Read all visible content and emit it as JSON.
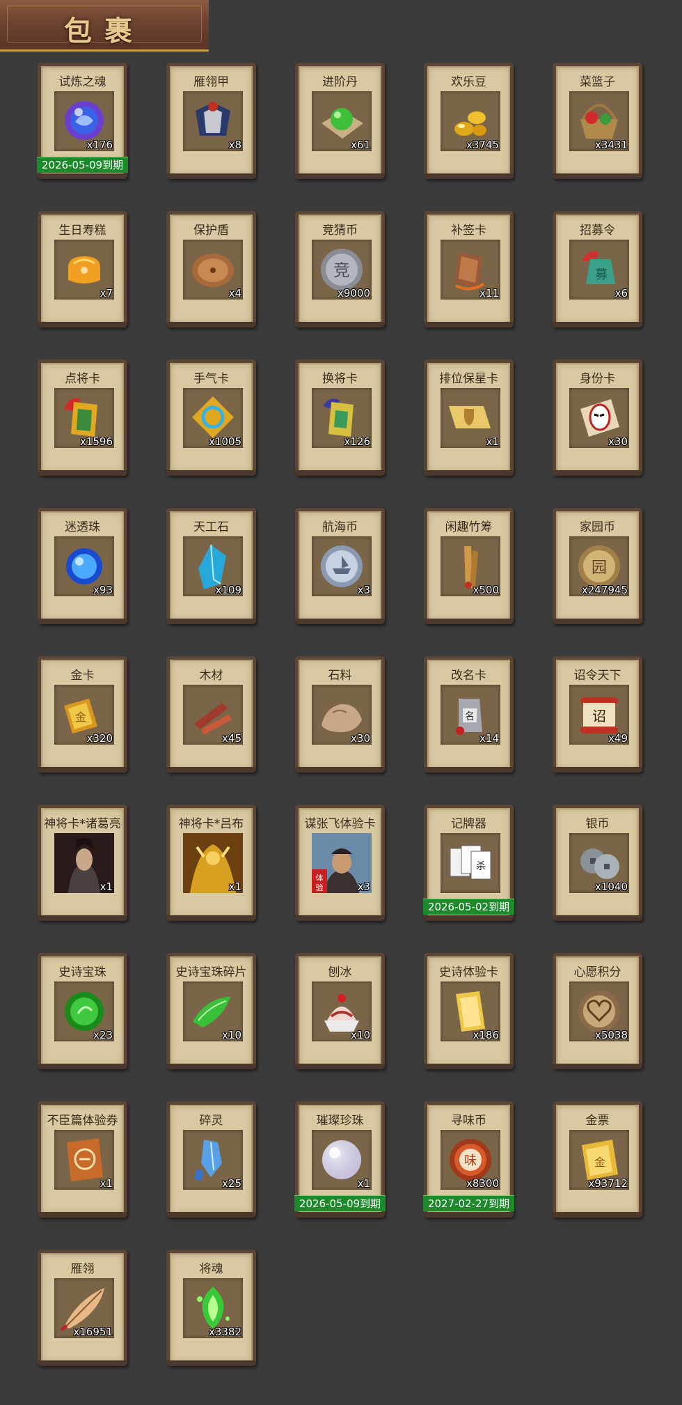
{
  "header": {
    "title": "包裹"
  },
  "items": [
    {
      "name": "试炼之魂",
      "qty": "x176",
      "icon": "purple-orb-icon",
      "expiry": "2026-05-09到期"
    },
    {
      "name": "雁翎甲",
      "qty": "x8",
      "icon": "armor-icon"
    },
    {
      "name": "进阶丹",
      "qty": "x61",
      "icon": "green-pill-icon"
    },
    {
      "name": "欢乐豆",
      "qty": "x3745",
      "icon": "gold-beans-icon"
    },
    {
      "name": "菜篮子",
      "qty": "x3431",
      "icon": "basket-icon"
    },
    {
      "name": "生日寿糕",
      "qty": "x7",
      "icon": "birthday-cake-icon"
    },
    {
      "name": "保护盾",
      "qty": "x4",
      "icon": "shield-icon"
    },
    {
      "name": "竞猜币",
      "qty": "x9000",
      "icon": "silver-coin-icon"
    },
    {
      "name": "补签卡",
      "qty": "x11",
      "icon": "sign-card-icon"
    },
    {
      "name": "招募令",
      "qty": "x6",
      "icon": "recruit-token-icon"
    },
    {
      "name": "点将卡",
      "qty": "x1596",
      "icon": "general-card-icon"
    },
    {
      "name": "手气卡",
      "qty": "x1005",
      "icon": "luck-card-icon"
    },
    {
      "name": "换将卡",
      "qty": "x126",
      "icon": "swap-card-icon"
    },
    {
      "name": "排位保星卡",
      "qty": "x1",
      "icon": "rank-card-icon"
    },
    {
      "name": "身份卡",
      "qty": "x30",
      "icon": "mask-card-icon"
    },
    {
      "name": "迷透珠",
      "qty": "x93",
      "icon": "blue-orb-icon"
    },
    {
      "name": "天工石",
      "qty": "x109",
      "icon": "crystal-icon"
    },
    {
      "name": "航海币",
      "qty": "x3",
      "icon": "ship-coin-icon"
    },
    {
      "name": "闲趣竹筹",
      "qty": "x500",
      "icon": "bamboo-tally-icon"
    },
    {
      "name": "家园币",
      "qty": "x247945",
      "icon": "home-coin-icon"
    },
    {
      "name": "金卡",
      "qty": "x320",
      "icon": "gold-card-icon"
    },
    {
      "name": "木材",
      "qty": "x45",
      "icon": "wood-icon"
    },
    {
      "name": "石料",
      "qty": "x30",
      "icon": "stone-icon"
    },
    {
      "name": "改名卡",
      "qty": "x14",
      "icon": "rename-card-icon"
    },
    {
      "name": "诏令天下",
      "qty": "x49",
      "icon": "scroll-icon"
    },
    {
      "name": "神将卡*诸葛亮",
      "qty": "x1",
      "icon": "hero-portrait-icon"
    },
    {
      "name": "神将卡*吕布",
      "qty": "x1",
      "icon": "golden-hero-icon"
    },
    {
      "name": "谋张飞体验卡",
      "qty": "x3",
      "icon": "trial-hero-icon"
    },
    {
      "name": "记牌器",
      "qty": "",
      "icon": "playing-cards-icon",
      "expiry": "2026-05-02到期"
    },
    {
      "name": "银币",
      "qty": "x1040",
      "icon": "silver-coins-icon"
    },
    {
      "name": "史诗宝珠",
      "qty": "x23",
      "icon": "green-orb-icon"
    },
    {
      "name": "史诗宝珠碎片",
      "qty": "x10",
      "icon": "green-shard-icon"
    },
    {
      "name": "刨冰",
      "qty": "x10",
      "icon": "shaved-ice-icon"
    },
    {
      "name": "史诗体验卡",
      "qty": "x186",
      "icon": "epic-card-icon"
    },
    {
      "name": "心愿积分",
      "qty": "x5038",
      "icon": "heart-coin-icon"
    },
    {
      "name": "不臣篇体验券",
      "qty": "x1",
      "icon": "ticket-icon"
    },
    {
      "name": "碎灵",
      "qty": "x25",
      "icon": "blue-shards-icon"
    },
    {
      "name": "璀璨珍珠",
      "qty": "x1",
      "icon": "pearl-icon",
      "expiry": "2026-05-09到期"
    },
    {
      "name": "寻味币",
      "qty": "x8300",
      "icon": "taste-coin-icon",
      "expiry": "2027-02-27到期"
    },
    {
      "name": "金票",
      "qty": "x93712",
      "icon": "gold-ticket-icon"
    },
    {
      "name": "雁翎",
      "qty": "x16951",
      "icon": "feather-icon"
    },
    {
      "name": "将魂",
      "qty": "x3382",
      "icon": "green-spirit-icon"
    }
  ]
}
